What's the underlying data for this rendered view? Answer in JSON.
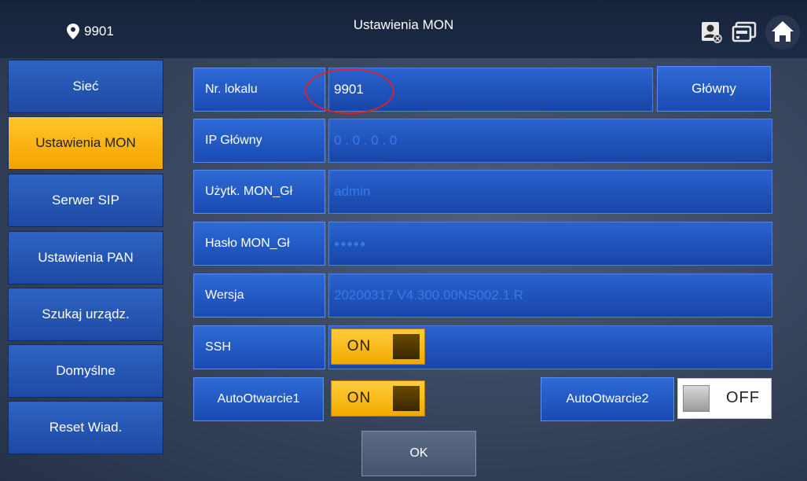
{
  "header": {
    "location": "9901",
    "title": "Ustawienia MON"
  },
  "sidebar": {
    "items": [
      {
        "label": "Sieć"
      },
      {
        "label": "Ustawienia MON"
      },
      {
        "label": "Serwer SIP"
      },
      {
        "label": "Ustawienia PAN"
      },
      {
        "label": "Szukaj urządz."
      },
      {
        "label": "Domyślne"
      },
      {
        "label": "Reset Wiad."
      }
    ],
    "active_index": 1
  },
  "form": {
    "room_label": "Nr. lokalu",
    "room_value": "9901",
    "main_button": "Główny",
    "ip_label": "IP Główny",
    "ip_value": "0  .  0  .  0  .  0",
    "user_label": "Użytk. MON_Gł",
    "user_value": "admin",
    "pass_label": "Hasło MON_Gł",
    "pass_value": "●●●●●",
    "version_label": "Wersja",
    "version_value": "20200317 V4.300.00NS002.1.R",
    "ssh_label": "SSH",
    "ssh_state": "ON",
    "auto1_label": "AutoOtwarcie1",
    "auto1_state": "ON",
    "auto2_label": "AutoOtwarcie2",
    "auto2_state": "OFF",
    "ok_label": "OK"
  },
  "icons": {
    "location": "location-pin-icon",
    "monitor": "monitor-person-icon",
    "intercom": "intercom-icon",
    "home": "home-icon"
  },
  "colors": {
    "accent": "#f5a300",
    "highlight": "#d8242a",
    "primary_blue": "#1d4aa4"
  }
}
